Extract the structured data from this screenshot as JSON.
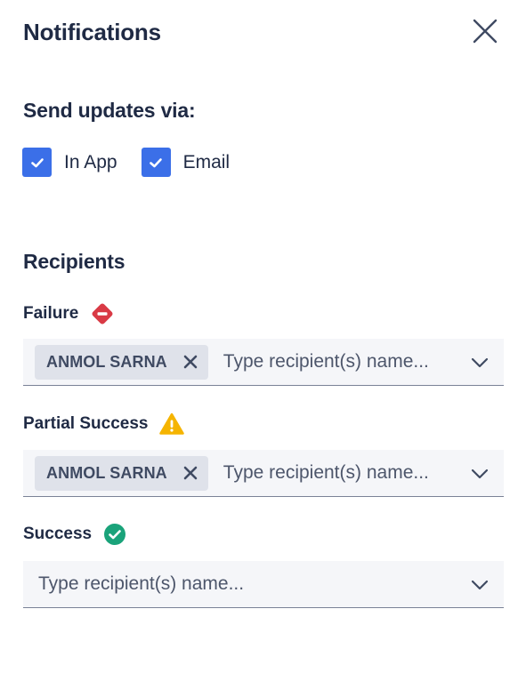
{
  "header": {
    "title": "Notifications"
  },
  "send_updates": {
    "title": "Send updates via:",
    "options": [
      {
        "label": "In App",
        "checked": true
      },
      {
        "label": "Email",
        "checked": true
      }
    ]
  },
  "recipients": {
    "title": "Recipients",
    "fields": [
      {
        "label": "Failure",
        "status_icon": "failure-icon",
        "chips": [
          "ANMOL SARNA"
        ],
        "placeholder": "Type recipient(s) name..."
      },
      {
        "label": "Partial Success",
        "status_icon": "warning-icon",
        "chips": [
          "ANMOL SARNA"
        ],
        "placeholder": "Type recipient(s) name..."
      },
      {
        "label": "Success",
        "status_icon": "success-icon",
        "chips": [],
        "placeholder": "Type recipient(s) name..."
      }
    ]
  },
  "colors": {
    "accent": "#3b6fe8",
    "text": "#1f2a44",
    "failure": "#d93a45",
    "warning": "#f5b400",
    "success": "#1aa37a"
  }
}
